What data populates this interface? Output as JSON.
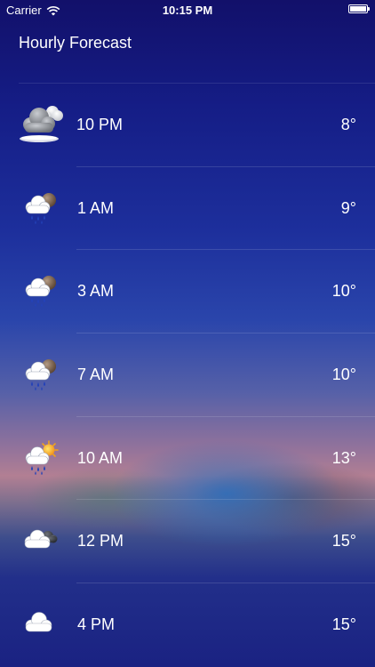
{
  "status_bar": {
    "carrier": "Carrier",
    "time": "10:15 PM",
    "wifi_icon": "wifi-icon",
    "battery_icon": "battery-icon"
  },
  "title": "Hourly Forecast",
  "forecast": [
    {
      "hour": "10 PM",
      "temp": "8°",
      "icon": "cloudy-night-icon"
    },
    {
      "hour": "1 AM",
      "temp": "9°",
      "icon": "night-rain-icon"
    },
    {
      "hour": "3 AM",
      "temp": "10°",
      "icon": "night-rain-icon"
    },
    {
      "hour": "7 AM",
      "temp": "10°",
      "icon": "night-rain-icon"
    },
    {
      "hour": "10 AM",
      "temp": "13°",
      "icon": "sun-rain-icon"
    },
    {
      "hour": "12 PM",
      "temp": "15°",
      "icon": "cloudy-icon"
    },
    {
      "hour": "4 PM",
      "temp": "15°",
      "icon": "cloud-icon"
    }
  ]
}
